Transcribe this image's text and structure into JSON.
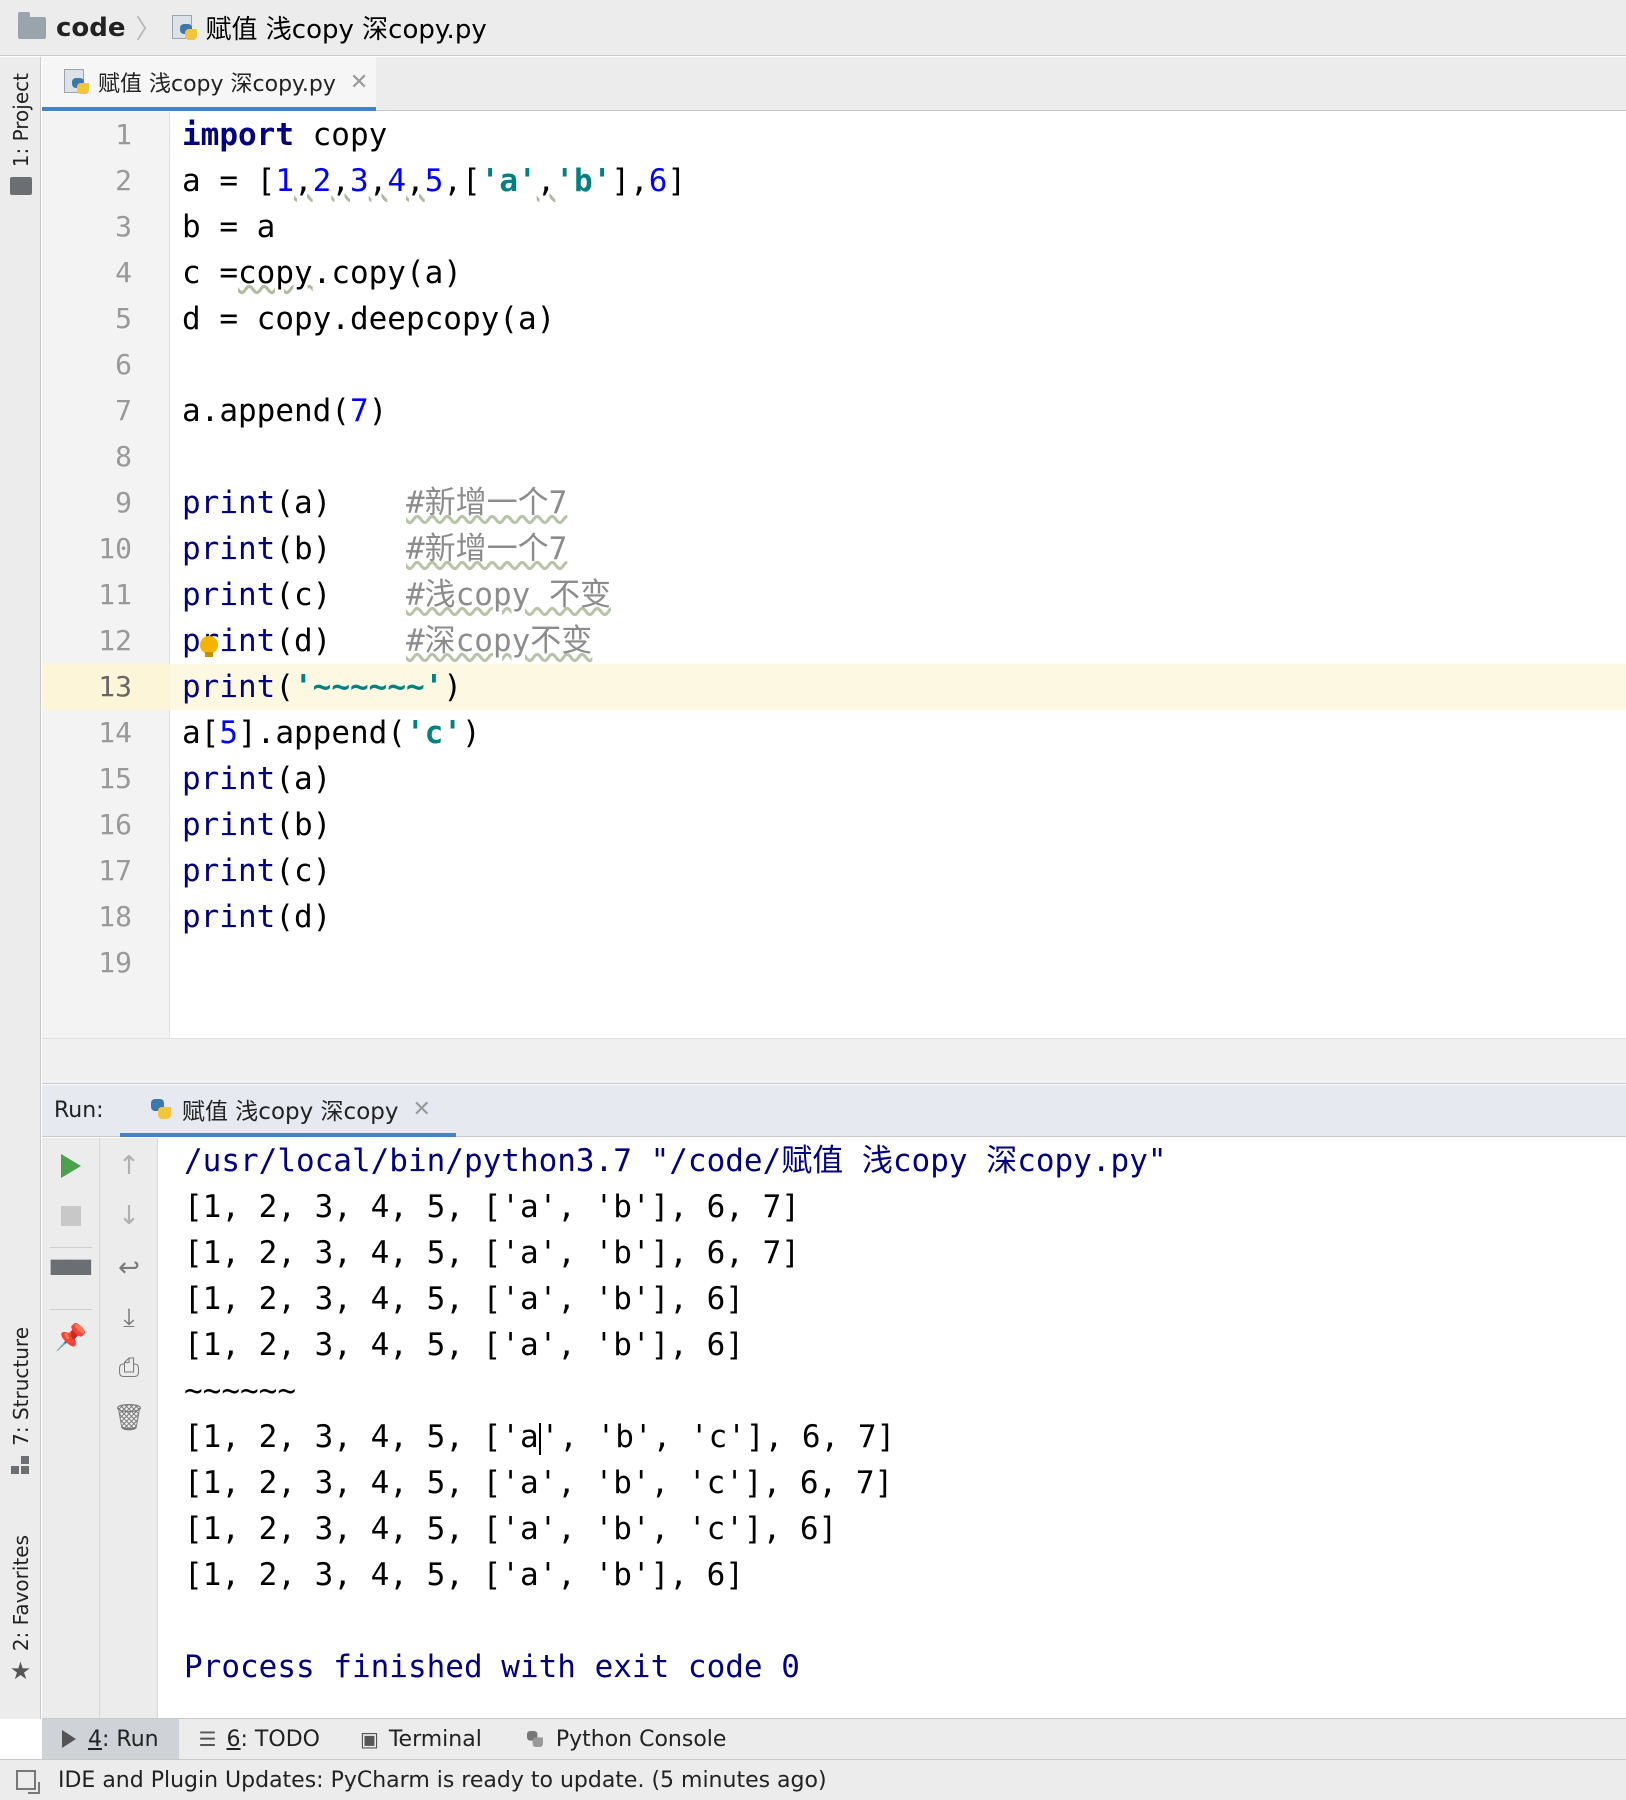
{
  "breadcrumb": {
    "folder": "code",
    "file": "赋值 浅copy 深copy.py"
  },
  "left_strip": {
    "project": "1: Project",
    "structure": "7: Structure",
    "favorites": "2: Favorites"
  },
  "editor": {
    "tab_label": "赋值 浅copy 深copy.py",
    "current_line": 13,
    "line_numbers": [
      "1",
      "2",
      "3",
      "4",
      "5",
      "6",
      "7",
      "8",
      "9",
      "10",
      "11",
      "12",
      "13",
      "14",
      "15",
      "16",
      "17",
      "18",
      "19"
    ],
    "code": {
      "l1": {
        "kw": "import",
        "rest": " copy"
      },
      "l2": {
        "a": "a = [",
        "n1": "1",
        "c1": ",",
        "n2": "2",
        "c2": ",",
        "n3": "3",
        "c3": ",",
        "n4": "4",
        "c4": ",",
        "n5": "5",
        "c5": ",[",
        "s1": "'a'",
        "c6": ",",
        "s2": "'b'",
        "c7": "],",
        "n6": "6",
        "end": "]"
      },
      "l3": "b = a",
      "l4": {
        "a": "c =",
        "b": "copy",
        "c": ".copy(a)"
      },
      "l5": "d = copy.deepcopy(a)",
      "l7": {
        "a": "a.append(",
        "n": "7",
        "b": ")"
      },
      "l9": {
        "fn": "print",
        "args": "(a)    ",
        "cmt": "#新增一个7"
      },
      "l10": {
        "fn": "print",
        "args": "(b)    ",
        "cmt": "#新增一个7"
      },
      "l11": {
        "fn": "print",
        "args": "(c)    ",
        "cmt": "#浅copy 不变"
      },
      "l12": {
        "fn": "print",
        "args": "(d)    ",
        "cmt": "#深copy不变"
      },
      "l13": {
        "fn": "print",
        "a": "(",
        "s": "'~~~~~~'",
        "b": ")"
      },
      "l14": {
        "a": "a[",
        "n": "5",
        "b": "].append(",
        "s": "'c'",
        "c": ")"
      },
      "l15": {
        "fn": "print",
        "args": "(a)"
      },
      "l16": {
        "fn": "print",
        "args": "(b)"
      },
      "l17": {
        "fn": "print",
        "args": "(c)"
      },
      "l18": {
        "fn": "print",
        "args": "(d)"
      }
    }
  },
  "run": {
    "label": "Run:",
    "tab_label": "赋值 浅copy 深copy",
    "command": "/usr/local/bin/python3.7 \"/code/赋值 浅copy 深copy.py\"",
    "output": [
      "[1, 2, 3, 4, 5, ['a', 'b'], 6, 7]",
      "[1, 2, 3, 4, 5, ['a', 'b'], 6, 7]",
      "[1, 2, 3, 4, 5, ['a', 'b'], 6]",
      "[1, 2, 3, 4, 5, ['a', 'b'], 6]",
      "~~~~~~",
      {
        "before_caret": "[1, 2, 3, 4, 5, ['a",
        "after_caret": "', 'b', 'c'], 6, 7]"
      },
      "[1, 2, 3, 4, 5, ['a', 'b', 'c'], 6, 7]",
      "[1, 2, 3, 4, 5, ['a', 'b', 'c'], 6]",
      "[1, 2, 3, 4, 5, ['a', 'b'], 6]"
    ],
    "exit_message": "Process finished with exit code 0"
  },
  "tool_windows": {
    "run": {
      "num": "4",
      "label": ": Run"
    },
    "todo": {
      "num": "6",
      "label": ": TODO"
    },
    "terminal": "Terminal",
    "python_console": "Python Console"
  },
  "status": "IDE and Plugin Updates: PyCharm is ready to update. (5 minutes ago)",
  "colors": {
    "keyword": "#000080",
    "number": "#0000ff",
    "string": "#008080",
    "comment": "#8c8c8c",
    "current_line": "#fdf8e2",
    "tab_underline": "#4083c9",
    "run_green": "#4aa24c"
  },
  "icons": [
    "folder-icon",
    "python-file-icon",
    "close-icon",
    "run-icon",
    "stop-icon",
    "layout-icon",
    "pin-icon",
    "up-arrow-icon",
    "down-arrow-icon",
    "soft-wrap-icon",
    "scroll-to-end-icon",
    "print-icon",
    "trash-icon",
    "todo-list-icon",
    "terminal-icon",
    "python-console-icon",
    "star-icon",
    "intention-bulb-icon"
  ]
}
